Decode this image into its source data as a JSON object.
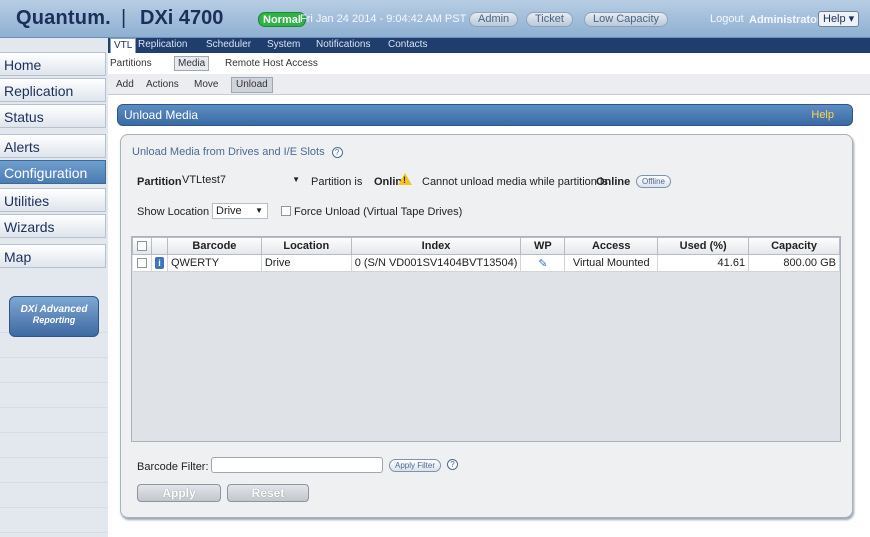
{
  "header": {
    "logo": "Quantum.",
    "separator": "|",
    "product": "DXi 4700",
    "status": "Normal",
    "datetime": "Fri Jan 24 2014 - 9:04:42 AM PST",
    "buttons": [
      "Admin",
      "Ticket",
      "Low Capacity"
    ],
    "logout": "Logout",
    "user": "Administrator",
    "help": "Help ▾"
  },
  "sidebar": {
    "items": [
      {
        "label": "Home"
      },
      {
        "label": "Replication"
      },
      {
        "label": "Status"
      },
      {
        "label": "Alerts"
      },
      {
        "label": "Configuration"
      },
      {
        "label": "Utilities"
      },
      {
        "label": "Wizards"
      },
      {
        "label": "Map"
      }
    ],
    "active": "Configuration",
    "badge": {
      "line1": "DXi Advanced",
      "line2": "Reporting"
    }
  },
  "tabs_level1": [
    "VTL",
    "Replication",
    "Scheduler",
    "System",
    "Notifications",
    "Contacts"
  ],
  "tabs_level2": [
    "Partitions",
    "Media",
    "Remote Host Access"
  ],
  "tabs_level3": [
    "Add",
    "Actions",
    "Move",
    "Unload"
  ],
  "title_bar": {
    "title": "Unload Media",
    "help": "Help"
  },
  "panel": {
    "section_title": "Unload Media from Drives and I/E Slots",
    "help_glyph": "?",
    "partition_label": "Partition",
    "partition_value": "VTLtest7",
    "partition_status_prefix": "Partition is",
    "partition_status": "Online",
    "warning_prefix": "Cannot unload media while partition is",
    "warning_state": "Online",
    "offline_button": "Offline",
    "show_location_label": "Show Location",
    "show_location_value": "Drive",
    "force_unload_label": "Force Unload (Virtual Tape Drives)",
    "barcode_filter_label": "Barcode Filter:",
    "barcode_filter_value": "",
    "apply_filter_button": "Apply Filter",
    "apply_button": "Apply",
    "reset_button": "Reset"
  },
  "table": {
    "columns": [
      "",
      "",
      "Barcode",
      "Location",
      "Index",
      "WP",
      "Access",
      "Used (%)",
      "Capacity"
    ],
    "rows": [
      {
        "barcode": "QWERTY",
        "location": "Drive",
        "index": "0 (S/N VD001SV1404BVT13504)",
        "wp": "pencil-icon",
        "access": "Virtual Mounted",
        "used": "41.61",
        "capacity": "800.00 GB"
      }
    ]
  },
  "colors": {
    "accent": "#3a6aa4",
    "nav_dark": "#1f3e6d",
    "status_green": "#2fb346",
    "help_yellow": "#ffd64a"
  }
}
